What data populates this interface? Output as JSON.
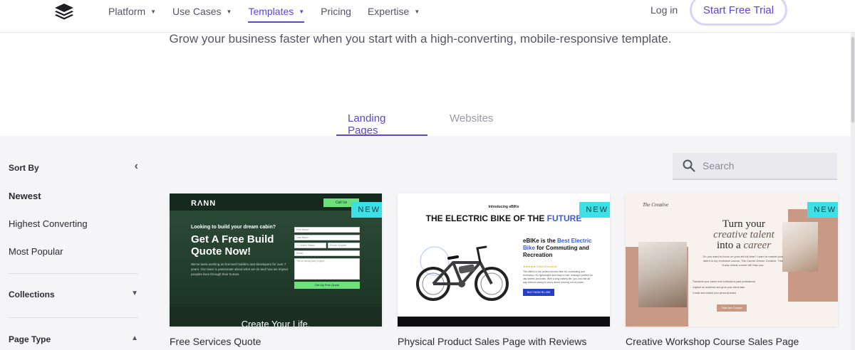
{
  "header": {
    "logo_icon": "layers-logo-icon",
    "nav": [
      {
        "label": "Platform",
        "caret": "▼"
      },
      {
        "label": "Use Cases",
        "caret": "▼"
      },
      {
        "label": "Templates",
        "caret": "▼"
      },
      {
        "label": "Pricing",
        "caret": ""
      },
      {
        "label": "Expertise",
        "caret": "▼"
      }
    ],
    "login": "Log in",
    "cta": "Start Free Trial"
  },
  "subtitle": "Grow your business faster when you start with a high-converting, mobile-responsive template.",
  "tabs": {
    "landing": "Landing Pages",
    "websites": "Websites"
  },
  "sidebar": {
    "sort_by": "Sort By",
    "options": [
      "Newest",
      "Highest Converting",
      "Most Popular"
    ],
    "collections": "Collections",
    "page_type": "Page Type"
  },
  "search": {
    "placeholder": "Search"
  },
  "cards": [
    {
      "badge": "NEW",
      "title": "Free Services Quote",
      "preview": {
        "brand": "RΛNN",
        "call": "Call Us",
        "small": "Looking to build your dream cabin?",
        "headline": "Get A Free Build Quote Now!",
        "para": "We've been working as licensed builders and developers for over 7 years. Our team is passionate about what we do and how we impact peoples lives through their homes.",
        "fields": [
          "First Name",
          "Last Name",
          "+1 United States",
          "Phone Number",
          "Email",
          "Tell us about your project"
        ],
        "submit": "Get My Free Quote",
        "footer": "Create Your Life."
      }
    },
    {
      "badge": "NEW",
      "title": "Physical Product Sales Page with Reviews",
      "preview": {
        "intro": "Introducing eBIKe",
        "headline_a": "THE ELECTRIC BIKE OF THE ",
        "headline_b": "FUTURE",
        "desc_a": "eBIKe is the ",
        "desc_b": "Best Electric Bike",
        "desc_c": " for Commuting and Recreation",
        "stars": "★★★★★ Rated Excellent",
        "para": "The eBIKe is the perfect electric bike for commuting and recreation. It's lightweight and easy to ride, making it perfect for city streets and trails. With a long battery life, you can ride all day without having to worry about running out of power.",
        "buy": "BUY NOW $1,450"
      }
    },
    {
      "badge": "NEW",
      "title": "Creative Workshop Course Sales Page",
      "preview": {
        "logo": "The Creative",
        "h_a": "Turn your",
        "h_b": "creative talent",
        "h_c": "into a ",
        "h_d": "career",
        "para": "Do you want to focus on your art full-time? Learn to market your talent in my exclusive course, The Career-Driven Creative. This 8-day virtual course will help you:",
        "bullets": [
          "Transform your career from hobbyist to paid professional",
          "Capture an audience and grow your client base",
          "Create and market your personal brand"
        ],
        "button": "Take the Course"
      }
    }
  ],
  "colors": {
    "accent": "#5b46d6",
    "badge": "#3ee0e8",
    "panel_bg": "#f5f5f7"
  }
}
